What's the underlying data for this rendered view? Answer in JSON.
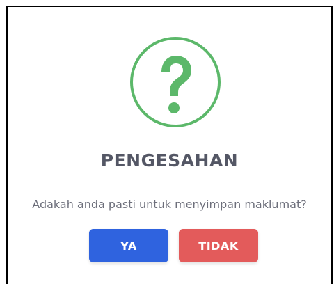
{
  "dialog": {
    "icon": "question-mark-icon",
    "title": "PENGESAHAN",
    "message": "Adakah anda pasti untuk menyimpan maklumat?",
    "yes_label": "YA",
    "no_label": "TIDAK"
  },
  "colors": {
    "icon_green": "#5cb86a",
    "title_text": "#545765",
    "message_text": "#6d6f7b",
    "yes_button": "#2f63df",
    "no_button": "#e35b5b"
  }
}
